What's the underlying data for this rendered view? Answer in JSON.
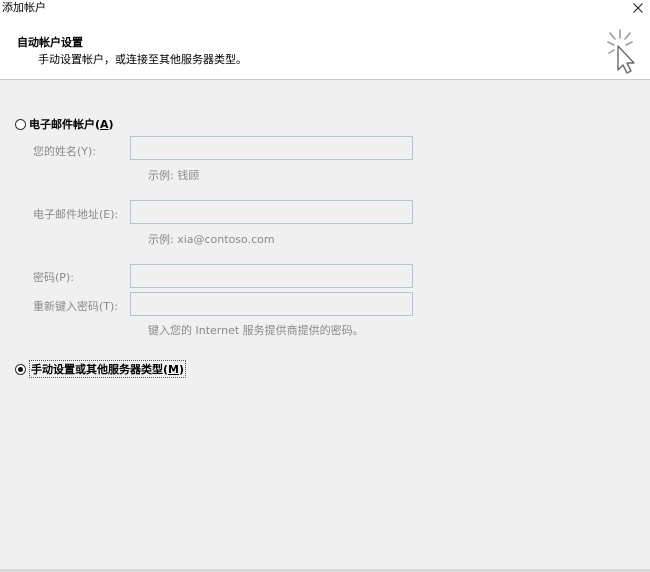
{
  "window": {
    "title": "添加帐户",
    "close_glyph": "✕"
  },
  "header": {
    "title": "自动帐户设置",
    "subtitle": "手动设置帐户，或连接至其他服务器类型。",
    "icon": "wizard-cursor-icon"
  },
  "email_option": {
    "label": "电子邮件帐户(",
    "mnemonic": "A",
    "label_end": ")",
    "checked": false
  },
  "fields": {
    "name": {
      "label": "您的姓名(Y):",
      "value": "",
      "hint": "示例: 钱顾"
    },
    "email": {
      "label": "电子邮件地址(E):",
      "value": "",
      "hint": "示例: xia@contoso.com"
    },
    "password": {
      "label": "密码(P):",
      "value": ""
    },
    "retype": {
      "label": "重新键入密码(T):",
      "value": "",
      "hint": "键入您的 Internet 服务提供商提供的密码。"
    }
  },
  "manual_option": {
    "label": "手动设置或其他服务器类型(",
    "mnemonic": "M",
    "label_end": ")",
    "checked": true
  },
  "colors": {
    "content_bg": "#f0f0f0",
    "disabled_text": "#8a8a8a",
    "input_border": "#b9c3d0"
  }
}
